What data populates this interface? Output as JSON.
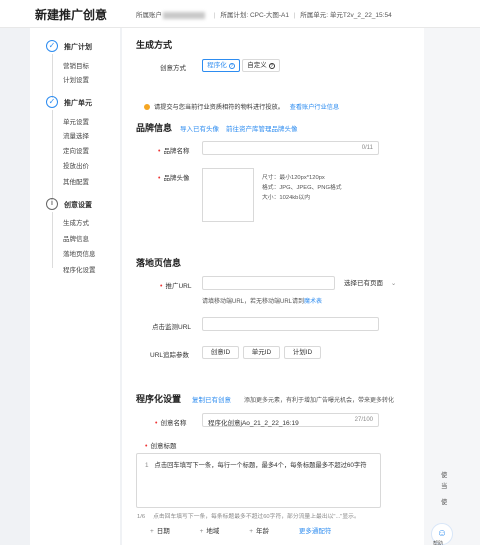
{
  "header": {
    "title": "新建推广创意",
    "account_label": "所属账户",
    "plan": "所属计划: CPC-大图-A1",
    "unit": "所属单元: 单元T2v_2_22_15:54"
  },
  "sidebar": {
    "steps": [
      {
        "title": "推广计划",
        "items": [
          "营销目标",
          "计划设置"
        ]
      },
      {
        "title": "推广单元",
        "items": [
          "单元设置",
          "流量选择",
          "定向设置",
          "投放出价",
          "其他配置"
        ]
      },
      {
        "title": "创意设置",
        "items": [
          "生成方式",
          "品牌信息",
          "落地页信息",
          "程序化设置"
        ]
      }
    ]
  },
  "generation": {
    "section_title": "生成方式",
    "label": "创意方式",
    "options": [
      "程序化",
      "自定义"
    ]
  },
  "notice": {
    "text": "请提交与您当前行业资质相符的物料进行投放。",
    "link": "查看账户行业信息"
  },
  "brand": {
    "section_title": "品牌信息",
    "import_link": "导入已有头像",
    "manage_link": "前往资产库管理品牌头像",
    "name_label": "品牌名称",
    "name_counter": "0/11",
    "avatar_label": "品牌头像",
    "spec_size": "尺寸：最小120px*120px",
    "spec_format": "格式：JPG、JPEG、PNG格式",
    "spec_filesize": "大小：1024kb以内"
  },
  "landing": {
    "section_title": "落地页信息",
    "url_label": "推广URL",
    "select_existing": "选择已有页面",
    "hint": "请填移动端URL，若无移动端URL请到",
    "hint_link": "魔术表",
    "monitor_label": "点击监测URL",
    "params_label": "URL追踪参数",
    "param_buttons": [
      "创意ID",
      "单元ID",
      "计划ID"
    ]
  },
  "programmatic": {
    "section_title": "程序化设置",
    "copy_link": "复制已有创意",
    "tip": "添加更多元素，有利于增加广告曝光机会，带来更多转化",
    "name_label": "创意名称",
    "name_value": "程序化创意jAo_21_2_22_16:19",
    "name_counter": "27/100",
    "headline_label": "创意标题",
    "line_number": "1",
    "headline_placeholder": "点击回车填写下一条，每行一个标题，最多4个，每条标题最多不超过60字符",
    "counter": "1/6",
    "bottom_hint": "点击回车填写下一条，每条标题最多不超过60字符，部分流量上最出以\"...\"显示。",
    "wildcards": [
      "日期",
      "地域",
      "年龄"
    ],
    "more_link": "更多通配符"
  },
  "right_rail": {
    "texts": [
      "使",
      "当",
      "使"
    ],
    "help_label": "帮助"
  }
}
